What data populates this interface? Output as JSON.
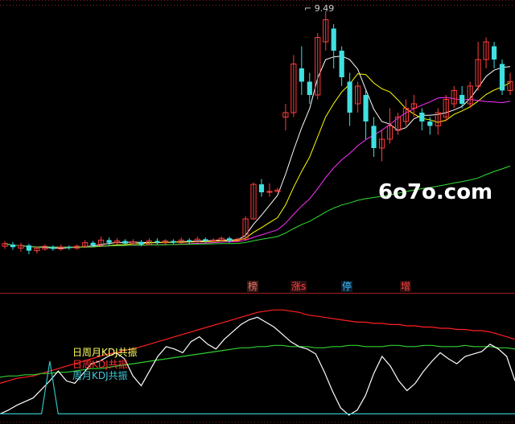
{
  "watermark": "6o7o.com",
  "peak_label": "9.49",
  "badges": [
    {
      "text": "榜",
      "color": "#e07070"
    },
    {
      "text": "涨s",
      "color": "#ff4040"
    },
    {
      "text": "停",
      "color": "#40c0ff"
    },
    {
      "text": "增",
      "color": "#ff4040"
    }
  ],
  "signals": [
    {
      "text": "日周月KDJ共振",
      "color": "#ffff60"
    },
    {
      "text": "日周KDJ共振",
      "color": "#ff3030"
    },
    {
      "text": "周月KDJ共振",
      "color": "#40c8d8"
    }
  ],
  "colors": {
    "up": "#ff3c3c",
    "down": "#40e0e0",
    "ma_white": "#ffffff",
    "ma_yellow": "#ffff00",
    "ma_magenta": "#ff30ff",
    "ma_green": "#30e030",
    "kdj_red": "#ff2020",
    "kdj_green": "#30d030",
    "kdj_white": "#ffffff",
    "kdj_cyan": "#30c0c0"
  },
  "chart_data": [
    {
      "type": "candlestick",
      "ylim": [
        3.6,
        9.6
      ],
      "candles": [
        [
          4.18,
          4.24,
          4.3,
          4.12
        ],
        [
          4.22,
          4.16,
          4.28,
          4.1
        ],
        [
          4.14,
          4.2,
          4.26,
          4.06
        ],
        [
          4.2,
          4.08,
          4.24,
          4.0
        ],
        [
          4.08,
          4.14,
          4.18,
          4.02
        ],
        [
          4.12,
          4.18,
          4.22,
          4.08
        ],
        [
          4.16,
          4.12,
          4.2,
          4.08
        ],
        [
          4.12,
          4.16,
          4.22,
          4.08
        ],
        [
          4.16,
          4.14,
          4.2,
          4.1
        ],
        [
          4.14,
          4.18,
          4.22,
          4.1
        ],
        [
          4.18,
          4.26,
          4.32,
          4.14
        ],
        [
          4.26,
          4.2,
          4.3,
          4.16
        ],
        [
          4.2,
          4.32,
          4.4,
          4.18
        ],
        [
          4.32,
          4.26,
          4.38,
          4.2
        ],
        [
          4.26,
          4.3,
          4.36,
          4.22
        ],
        [
          4.3,
          4.24,
          4.34,
          4.2
        ],
        [
          4.24,
          4.28,
          4.34,
          4.2
        ],
        [
          4.28,
          4.22,
          4.32,
          4.18
        ],
        [
          4.22,
          4.3,
          4.36,
          4.2
        ],
        [
          4.3,
          4.26,
          4.36,
          4.22
        ],
        [
          4.26,
          4.3,
          4.34,
          4.22
        ],
        [
          4.3,
          4.26,
          4.34,
          4.22
        ],
        [
          4.26,
          4.32,
          4.38,
          4.24
        ],
        [
          4.32,
          4.28,
          4.36,
          4.24
        ],
        [
          4.28,
          4.34,
          4.4,
          4.26
        ],
        [
          4.34,
          4.3,
          4.38,
          4.26
        ],
        [
          4.3,
          4.32,
          4.36,
          4.28
        ],
        [
          4.32,
          4.36,
          4.4,
          4.3
        ],
        [
          4.36,
          4.3,
          4.4,
          4.26
        ],
        [
          4.3,
          4.34,
          4.38,
          4.28
        ],
        [
          4.34,
          4.8,
          4.86,
          4.32
        ],
        [
          4.8,
          5.58,
          5.62,
          4.78
        ],
        [
          5.58,
          5.4,
          5.7,
          5.3
        ],
        [
          5.4,
          5.42,
          5.6,
          5.3
        ],
        [
          5.42,
          5.45,
          5.5,
          5.4
        ],
        [
          7.1,
          7.2,
          7.4,
          6.8
        ],
        [
          7.2,
          8.3,
          8.5,
          7.1
        ],
        [
          8.2,
          7.9,
          8.7,
          7.6
        ],
        [
          7.9,
          7.6,
          8.1,
          7.4
        ],
        [
          7.6,
          8.9,
          9.0,
          7.5
        ],
        [
          8.8,
          9.3,
          9.49,
          8.6
        ],
        [
          9.1,
          8.6,
          9.2,
          8.2
        ],
        [
          8.6,
          8.0,
          8.7,
          7.8
        ],
        [
          7.9,
          7.2,
          8.1,
          6.9
        ],
        [
          7.4,
          7.8,
          7.9,
          7.2
        ],
        [
          7.6,
          7.0,
          7.7,
          6.6
        ],
        [
          6.9,
          6.4,
          7.1,
          6.2
        ],
        [
          6.4,
          6.6,
          6.8,
          6.1
        ],
        [
          6.6,
          6.9,
          7.3,
          6.5
        ],
        [
          6.8,
          7.1,
          7.2,
          6.7
        ],
        [
          7.0,
          7.3,
          7.5,
          6.9
        ],
        [
          7.3,
          7.4,
          7.6,
          7.1
        ],
        [
          7.2,
          7.0,
          7.3,
          6.8
        ],
        [
          7.0,
          6.9,
          7.1,
          6.7
        ],
        [
          6.9,
          7.2,
          7.3,
          6.7
        ],
        [
          7.1,
          7.5,
          7.6,
          7.0
        ],
        [
          7.4,
          7.7,
          7.8,
          7.3
        ],
        [
          7.6,
          7.4,
          7.8,
          7.3
        ],
        [
          7.4,
          7.8,
          7.9,
          7.3
        ],
        [
          7.8,
          8.4,
          8.8,
          7.7
        ],
        [
          8.4,
          8.8,
          8.9,
          8.2
        ],
        [
          8.7,
          8.4,
          8.8,
          8.2
        ],
        [
          8.3,
          7.7,
          8.4,
          7.6
        ],
        [
          7.7,
          7.9,
          8.1,
          7.6
        ]
      ]
    },
    {
      "type": "line",
      "ylim": [
        0,
        100
      ],
      "series": [
        {
          "values": [
            30,
            32,
            34,
            35,
            36,
            38,
            40,
            42,
            44,
            46,
            48,
            50,
            52,
            54,
            55,
            57,
            58,
            60,
            62,
            64,
            66,
            68,
            70,
            72,
            74,
            76,
            78,
            80,
            82,
            84,
            86,
            88,
            89,
            90,
            90,
            89,
            88,
            86,
            85,
            84,
            83,
            82,
            81,
            80,
            80,
            79,
            79,
            78,
            78,
            77,
            77,
            76,
            76,
            75,
            75,
            74,
            74,
            73,
            73,
            72,
            70,
            68,
            66
          ]
        },
        {
          "values": [
            35,
            36,
            36,
            37,
            37,
            38,
            38,
            39,
            39,
            40,
            41,
            42,
            42,
            43,
            44,
            45,
            46,
            47,
            48,
            49,
            50,
            51,
            52,
            53,
            54,
            55,
            56,
            57,
            58,
            59,
            59,
            60,
            60,
            61,
            61,
            60,
            60,
            60,
            59,
            59,
            60,
            60,
            61,
            61,
            60,
            60,
            60,
            61,
            61,
            60,
            60,
            61,
            61,
            60,
            60,
            60,
            61,
            60,
            60,
            60,
            59,
            59,
            58
          ]
        },
        {
          "values": [
            5,
            8,
            12,
            15,
            18,
            25,
            32,
            40,
            32,
            30,
            38,
            46,
            48,
            52,
            55,
            50,
            36,
            28,
            40,
            52,
            60,
            58,
            55,
            64,
            68,
            62,
            58,
            66,
            72,
            78,
            82,
            84,
            80,
            76,
            70,
            64,
            60,
            58,
            54,
            40,
            24,
            10,
            4,
            8,
            20,
            38,
            52,
            44,
            32,
            24,
            30,
            40,
            48,
            55,
            50,
            46,
            52,
            54,
            56,
            62,
            58,
            52,
            32
          ]
        },
        {
          "values": [
            5,
            5,
            5,
            5,
            5,
            5,
            48,
            5,
            5,
            5,
            5,
            5,
            5,
            5,
            5,
            5,
            5,
            5,
            5,
            5,
            5,
            5,
            5,
            5,
            5,
            5,
            5,
            5,
            5,
            5,
            5,
            5,
            5,
            5,
            5,
            5,
            5,
            5,
            5,
            5,
            5,
            5,
            5,
            5,
            5,
            5,
            5,
            5,
            5,
            5,
            5,
            5,
            5,
            5,
            5,
            5,
            5,
            5,
            5,
            5,
            5,
            5,
            5
          ]
        }
      ]
    }
  ]
}
